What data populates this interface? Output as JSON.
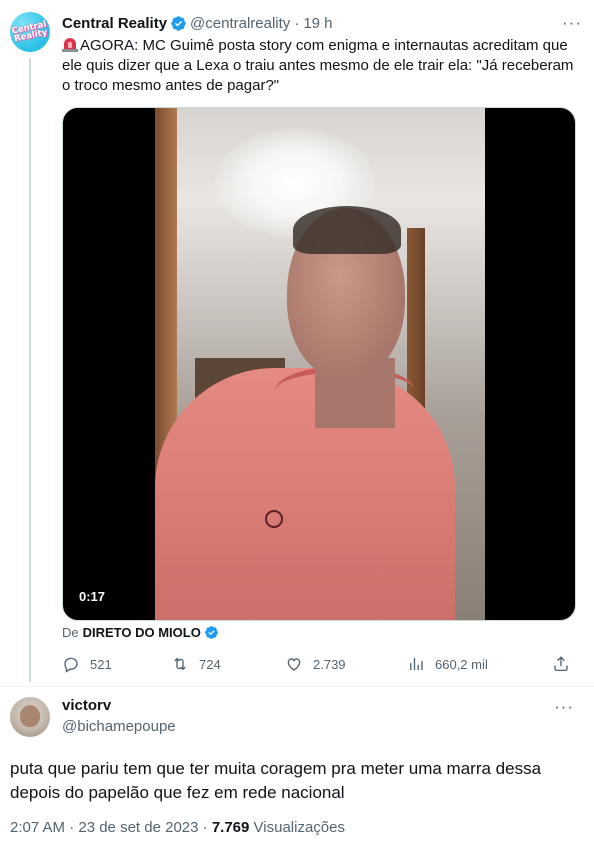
{
  "tweet": {
    "avatar_label": "Central Reality",
    "author_name": "Central Reality",
    "author_handle": "@centralreality",
    "separator": "·",
    "time_ago": "19 h",
    "more_label": "···",
    "text": "AGORA: MC Guimê posta story com enigma e internautas acreditam que ele quis dizer que a Lexa o traiu antes mesmo de ele trair ela: \"Já receberam o troco mesmo antes de pagar?\"",
    "video_duration": "0:17",
    "source_prefix": "De",
    "source_account": "DIRETO DO MIOLO",
    "stats": {
      "replies": "521",
      "retweets": "724",
      "likes": "2.739",
      "views": "660,2 mil"
    }
  },
  "reply": {
    "author_name": "victorv",
    "author_handle": "@bichamepoupe",
    "more_label": "···",
    "text": "puta que pariu tem que ter muita coragem pra meter uma marra dessa depois do papelão que fez em rede nacional",
    "timestamp": "2:07 AM · 23 de set de 2023 ·",
    "views_count": "7.769",
    "views_label": "Visualizações"
  },
  "colors": {
    "verified": "#1d9bf0",
    "secondary_text": "#536471",
    "primary_text": "#0f1419",
    "siren": "#e0334a"
  }
}
